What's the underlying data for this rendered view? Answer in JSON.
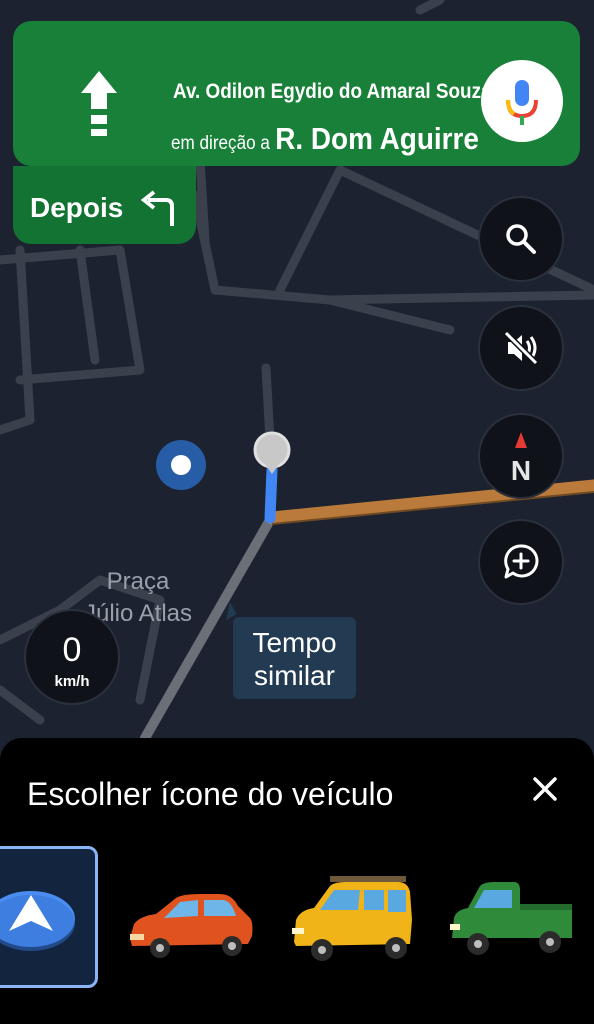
{
  "navigation": {
    "street": "Av. Odilon Egydio do Amaral Souza",
    "toward_prefix": "em direção a",
    "destination": "R. Dom Aguirre",
    "then_label": "Depois"
  },
  "map": {
    "place_name_line1": "Praça",
    "place_name_line2": "Júlio Atlas",
    "callout_line1": "Tempo",
    "callout_line2": "similar",
    "compass_letter": "N"
  },
  "speedometer": {
    "value": "0",
    "unit": "km/h"
  },
  "vehicle_sheet": {
    "title": "Escolher ícone do veículo",
    "options": [
      "navigation-arrow",
      "red-sedan",
      "yellow-suv",
      "green-pickup"
    ],
    "selected": "navigation-arrow"
  },
  "colors": {
    "banner_green": "#188038",
    "then_green": "#137333",
    "route_blue": "#4285f4",
    "route_orange": "#b97a3b"
  },
  "icons": [
    "arrow-up-icon",
    "mic-icon",
    "turn-left-icon",
    "search-icon",
    "mute-icon",
    "compass-icon",
    "add-report-icon",
    "close-icon"
  ]
}
